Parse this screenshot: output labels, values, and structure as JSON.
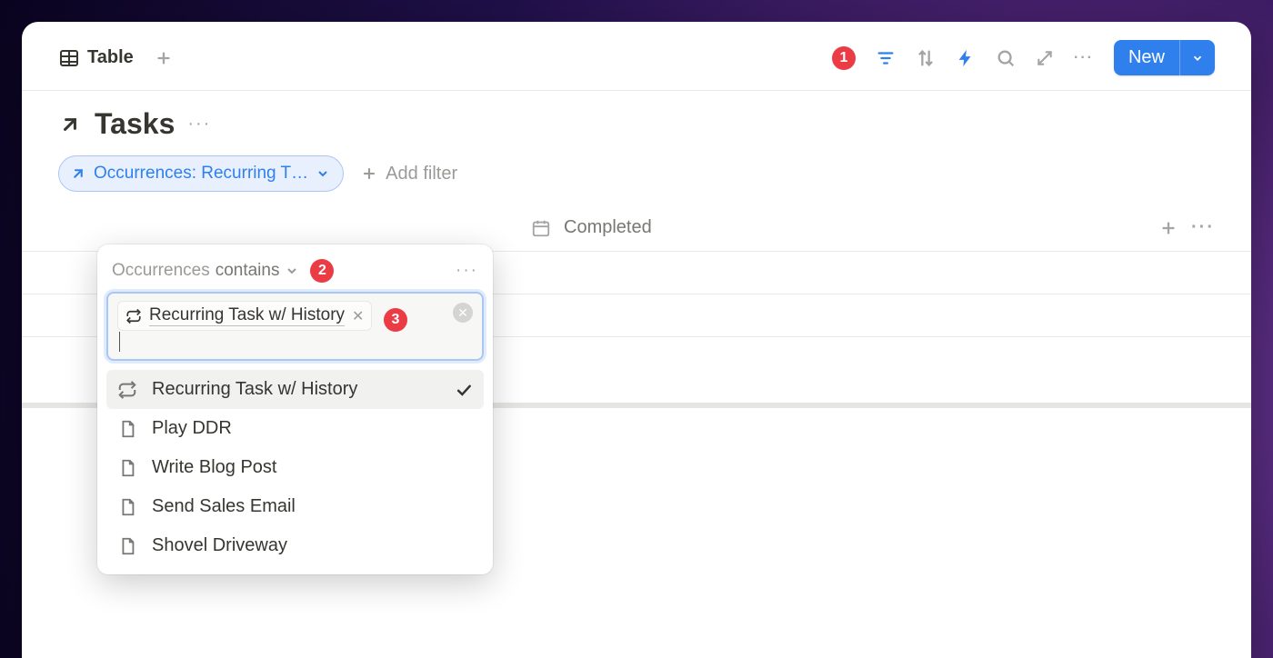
{
  "tabs": {
    "active_view": "Table"
  },
  "toolbar": {
    "filter_badge": "1",
    "new_label": "New"
  },
  "page": {
    "title": "Tasks"
  },
  "filters": {
    "chip_label": "Occurrences: Recurring T…",
    "add_filter_label": "Add filter"
  },
  "columns": {
    "completed_label": "Completed"
  },
  "dropdown": {
    "property_label": "Occurrences",
    "operator_label": "contains",
    "header_badge": "2",
    "token_label": "Recurring Task w/ History",
    "token_badge": "3",
    "options": [
      {
        "label": "Recurring Task w/ History",
        "icon": "repeat",
        "selected": true
      },
      {
        "label": "Play DDR",
        "icon": "page",
        "selected": false
      },
      {
        "label": "Write Blog Post",
        "icon": "page",
        "selected": false
      },
      {
        "label": "Send Sales Email",
        "icon": "page",
        "selected": false
      },
      {
        "label": "Shovel Driveway",
        "icon": "page",
        "selected": false
      }
    ]
  }
}
